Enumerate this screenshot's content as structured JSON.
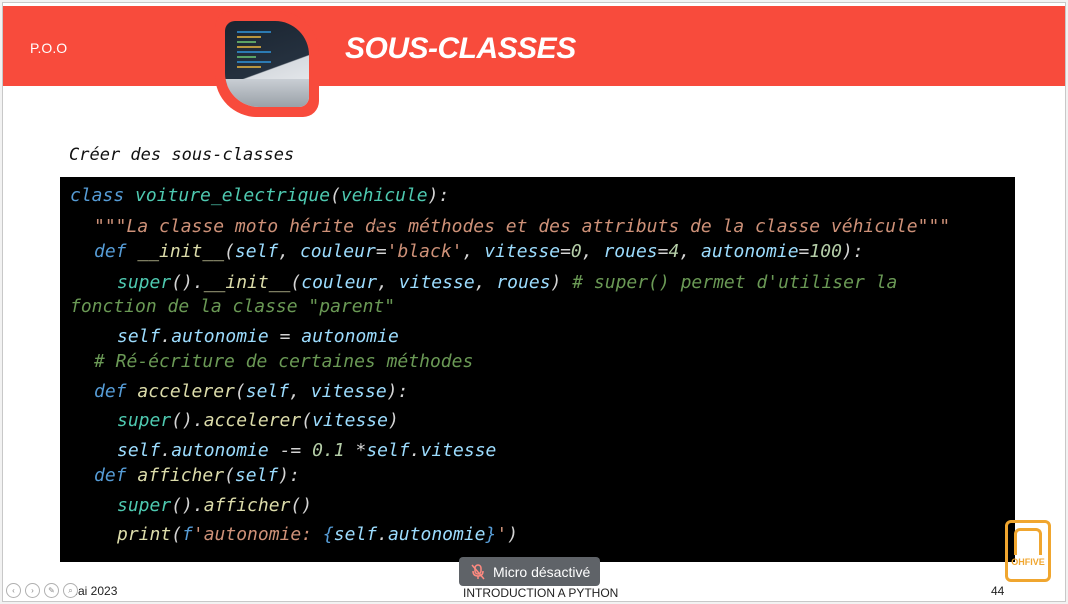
{
  "header": {
    "section_label": "P.O.O",
    "title": "SOUS-CLASSES"
  },
  "slide": {
    "subtitle": "Créer des sous-classes"
  },
  "code": {
    "lines": [
      "class voiture_electrique(vehicule):",
      "\"\"\"La classe moto hérite des méthodes et des attributs de la classe véhicule\"\"\"",
      "def __init__(self, couleur='black', vitesse=0, roues=4, autonomie=100):",
      "super().__init__(couleur, vitesse, roues) # super() permet d'utiliser la",
      "fonction de la classe \"parent\"",
      "self.autonomie = autonomie",
      "# Ré-écriture de certaines méthodes",
      "def accelerer(self, vitesse):",
      "super().accelerer(vitesse)",
      "self.autonomie -= 0.1 *self.vitesse",
      "def afficher(self):",
      "super().afficher()",
      "print(f'autonomie: {self.autonomie}')"
    ]
  },
  "footer": {
    "date": "Mai 2023",
    "course": "INTRODUCTION A PYTHON",
    "page": "44"
  },
  "toast": {
    "mic_status": "Micro désactivé",
    "icon": "mic-off-icon"
  },
  "logo": {
    "text": "OHFIVE"
  },
  "colors": {
    "header_bg": "#f84b3c",
    "code_bg": "#000000",
    "keyword": "#569cd6",
    "string": "#ce9178",
    "comment": "#6a9955"
  }
}
